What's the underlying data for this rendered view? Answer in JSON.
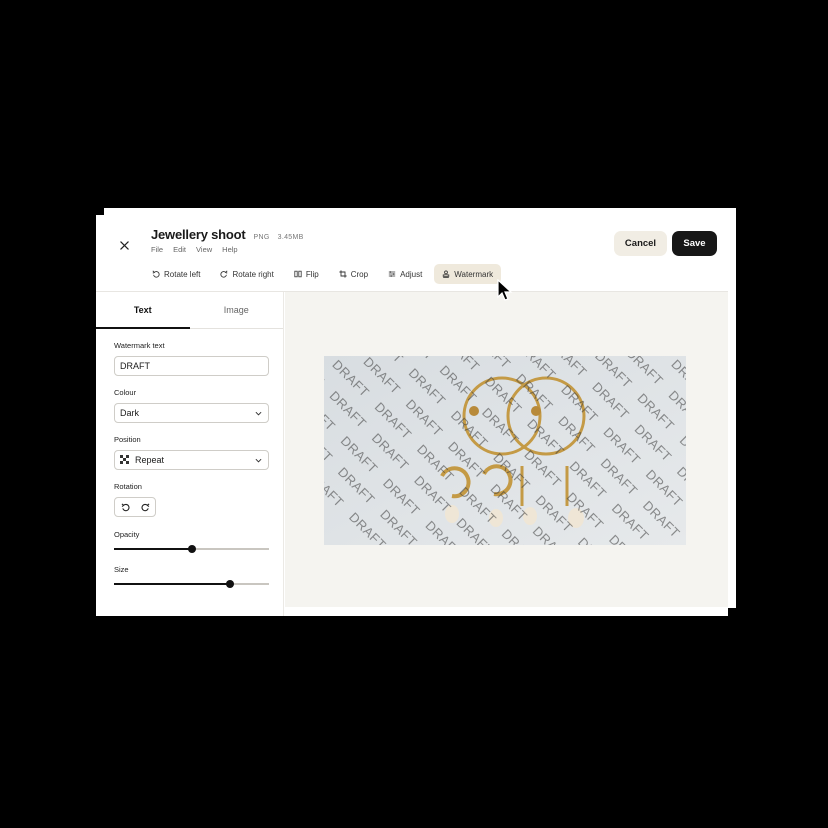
{
  "header": {
    "title": "Jewellery shoot",
    "format": "PNG",
    "size": "3.45MB",
    "menus": [
      "File",
      "Edit",
      "View",
      "Help"
    ],
    "cancel_label": "Cancel",
    "save_label": "Save"
  },
  "toolbar": {
    "items": [
      {
        "label": "Rotate left",
        "icon": "rotate-left-icon"
      },
      {
        "label": "Rotate right",
        "icon": "rotate-right-icon"
      },
      {
        "label": "Flip",
        "icon": "flip-icon"
      },
      {
        "label": "Crop",
        "icon": "crop-icon"
      },
      {
        "label": "Adjust",
        "icon": "adjust-icon"
      },
      {
        "label": "Watermark",
        "icon": "stamp-icon",
        "active": true
      }
    ]
  },
  "sidebar": {
    "tabs": [
      {
        "label": "Text",
        "active": true
      },
      {
        "label": "Image",
        "active": false
      }
    ],
    "watermark_text_label": "Watermark text",
    "watermark_text_value": "DRAFT",
    "colour_label": "Colour",
    "colour_value": "Dark",
    "position_label": "Position",
    "position_value": "Repeat",
    "rotation_label": "Rotation",
    "opacity_label": "Opacity",
    "opacity_value": 0.5,
    "size_label": "Size",
    "size_value": 0.75
  },
  "canvas": {
    "watermark_text": "DRAFT",
    "background_color": "#f5f4f0"
  },
  "colors": {
    "accent_active": "#efe9dc",
    "save_bg": "#171717",
    "cancel_bg": "#f1ede4"
  }
}
